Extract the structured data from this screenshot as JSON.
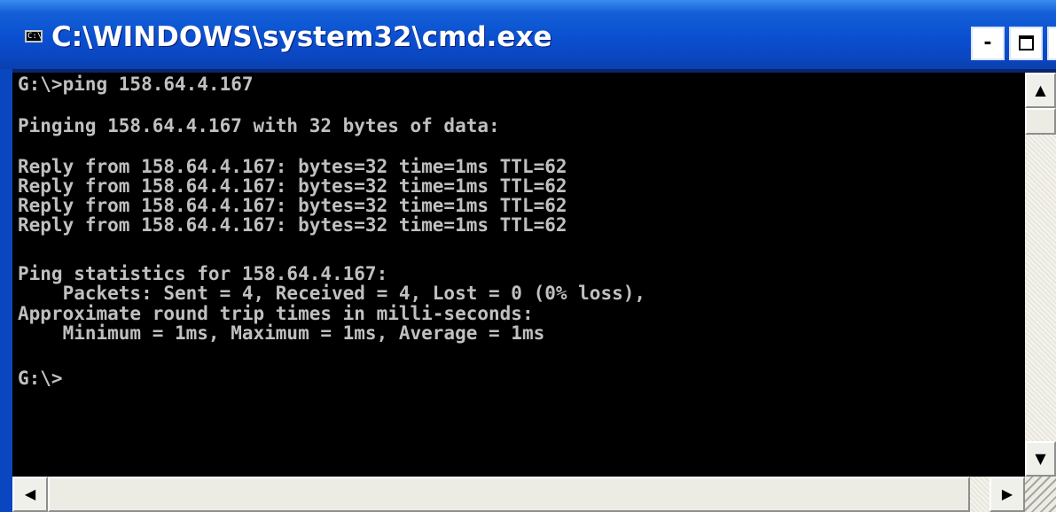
{
  "window": {
    "title": "C:\\WINDOWS\\system32\\cmd.exe",
    "icon_label": "C:\\",
    "minimize_label": "-",
    "close_label": "×"
  },
  "console": {
    "lines": [
      "G:\\>ping 158.64.4.167",
      "",
      "Pinging 158.64.4.167 with 32 bytes of data:",
      "",
      "Reply from 158.64.4.167: bytes=32 time=1ms TTL=62",
      "Reply from 158.64.4.167: bytes=32 time=1ms TTL=62",
      "Reply from 158.64.4.167: bytes=32 time=1ms TTL=62",
      "Reply from 158.64.4.167: bytes=32 time=1ms TTL=62",
      "",
      "Ping statistics for 158.64.4.167:",
      "    Packets: Sent = 4, Received = 4, Lost = 0 (0% loss),",
      "Approximate round trip times in milli-seconds:",
      "    Minimum = 1ms, Maximum = 1ms, Average = 1ms",
      "",
      "G:\\>"
    ],
    "foreground": "#c0c0c0",
    "background": "#000000"
  },
  "scrollbars": {
    "up_arrow": "▲",
    "down_arrow": "▼",
    "left_arrow": "◀",
    "right_arrow": "▶"
  },
  "colors": {
    "titlebar": "#0a4fd0",
    "title_text": "#ffffff"
  }
}
